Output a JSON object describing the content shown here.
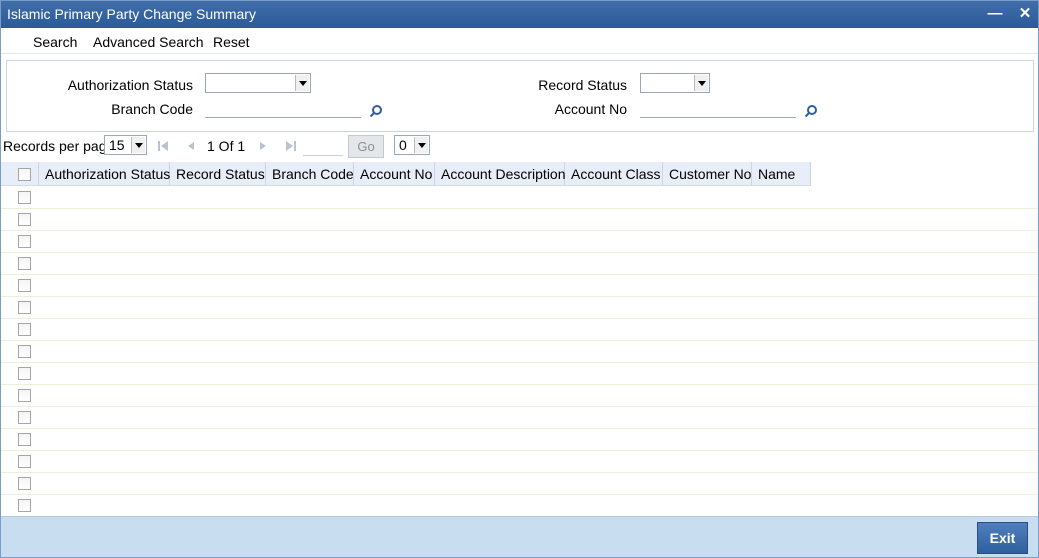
{
  "window": {
    "title": "Islamic Primary Party Change Summary"
  },
  "menu": {
    "search": "Search",
    "advanced_search": "Advanced Search",
    "reset": "Reset"
  },
  "criteria": {
    "authorization_status_label": "Authorization Status",
    "authorization_status_value": "",
    "branch_code_label": "Branch Code",
    "branch_code_value": "",
    "record_status_label": "Record Status",
    "record_status_value": "",
    "account_no_label": "Account No",
    "account_no_value": ""
  },
  "pager": {
    "records_per_page_label": "Records per page",
    "records_per_page": "15",
    "page_info": "1 Of 1",
    "go_label": "Go",
    "page_select": "0"
  },
  "grid": {
    "columns": [
      "Authorization Status",
      "Record Status",
      "Branch Code",
      "Account No",
      "Account Description",
      "Account Class",
      "Customer No",
      "Name"
    ],
    "row_count": 15
  },
  "footer": {
    "exit_label": "Exit"
  },
  "icons": {
    "search": "search-icon",
    "first": "first-page-icon",
    "prev": "prev-page-icon",
    "next": "next-page-icon",
    "last": "last-page-icon"
  }
}
